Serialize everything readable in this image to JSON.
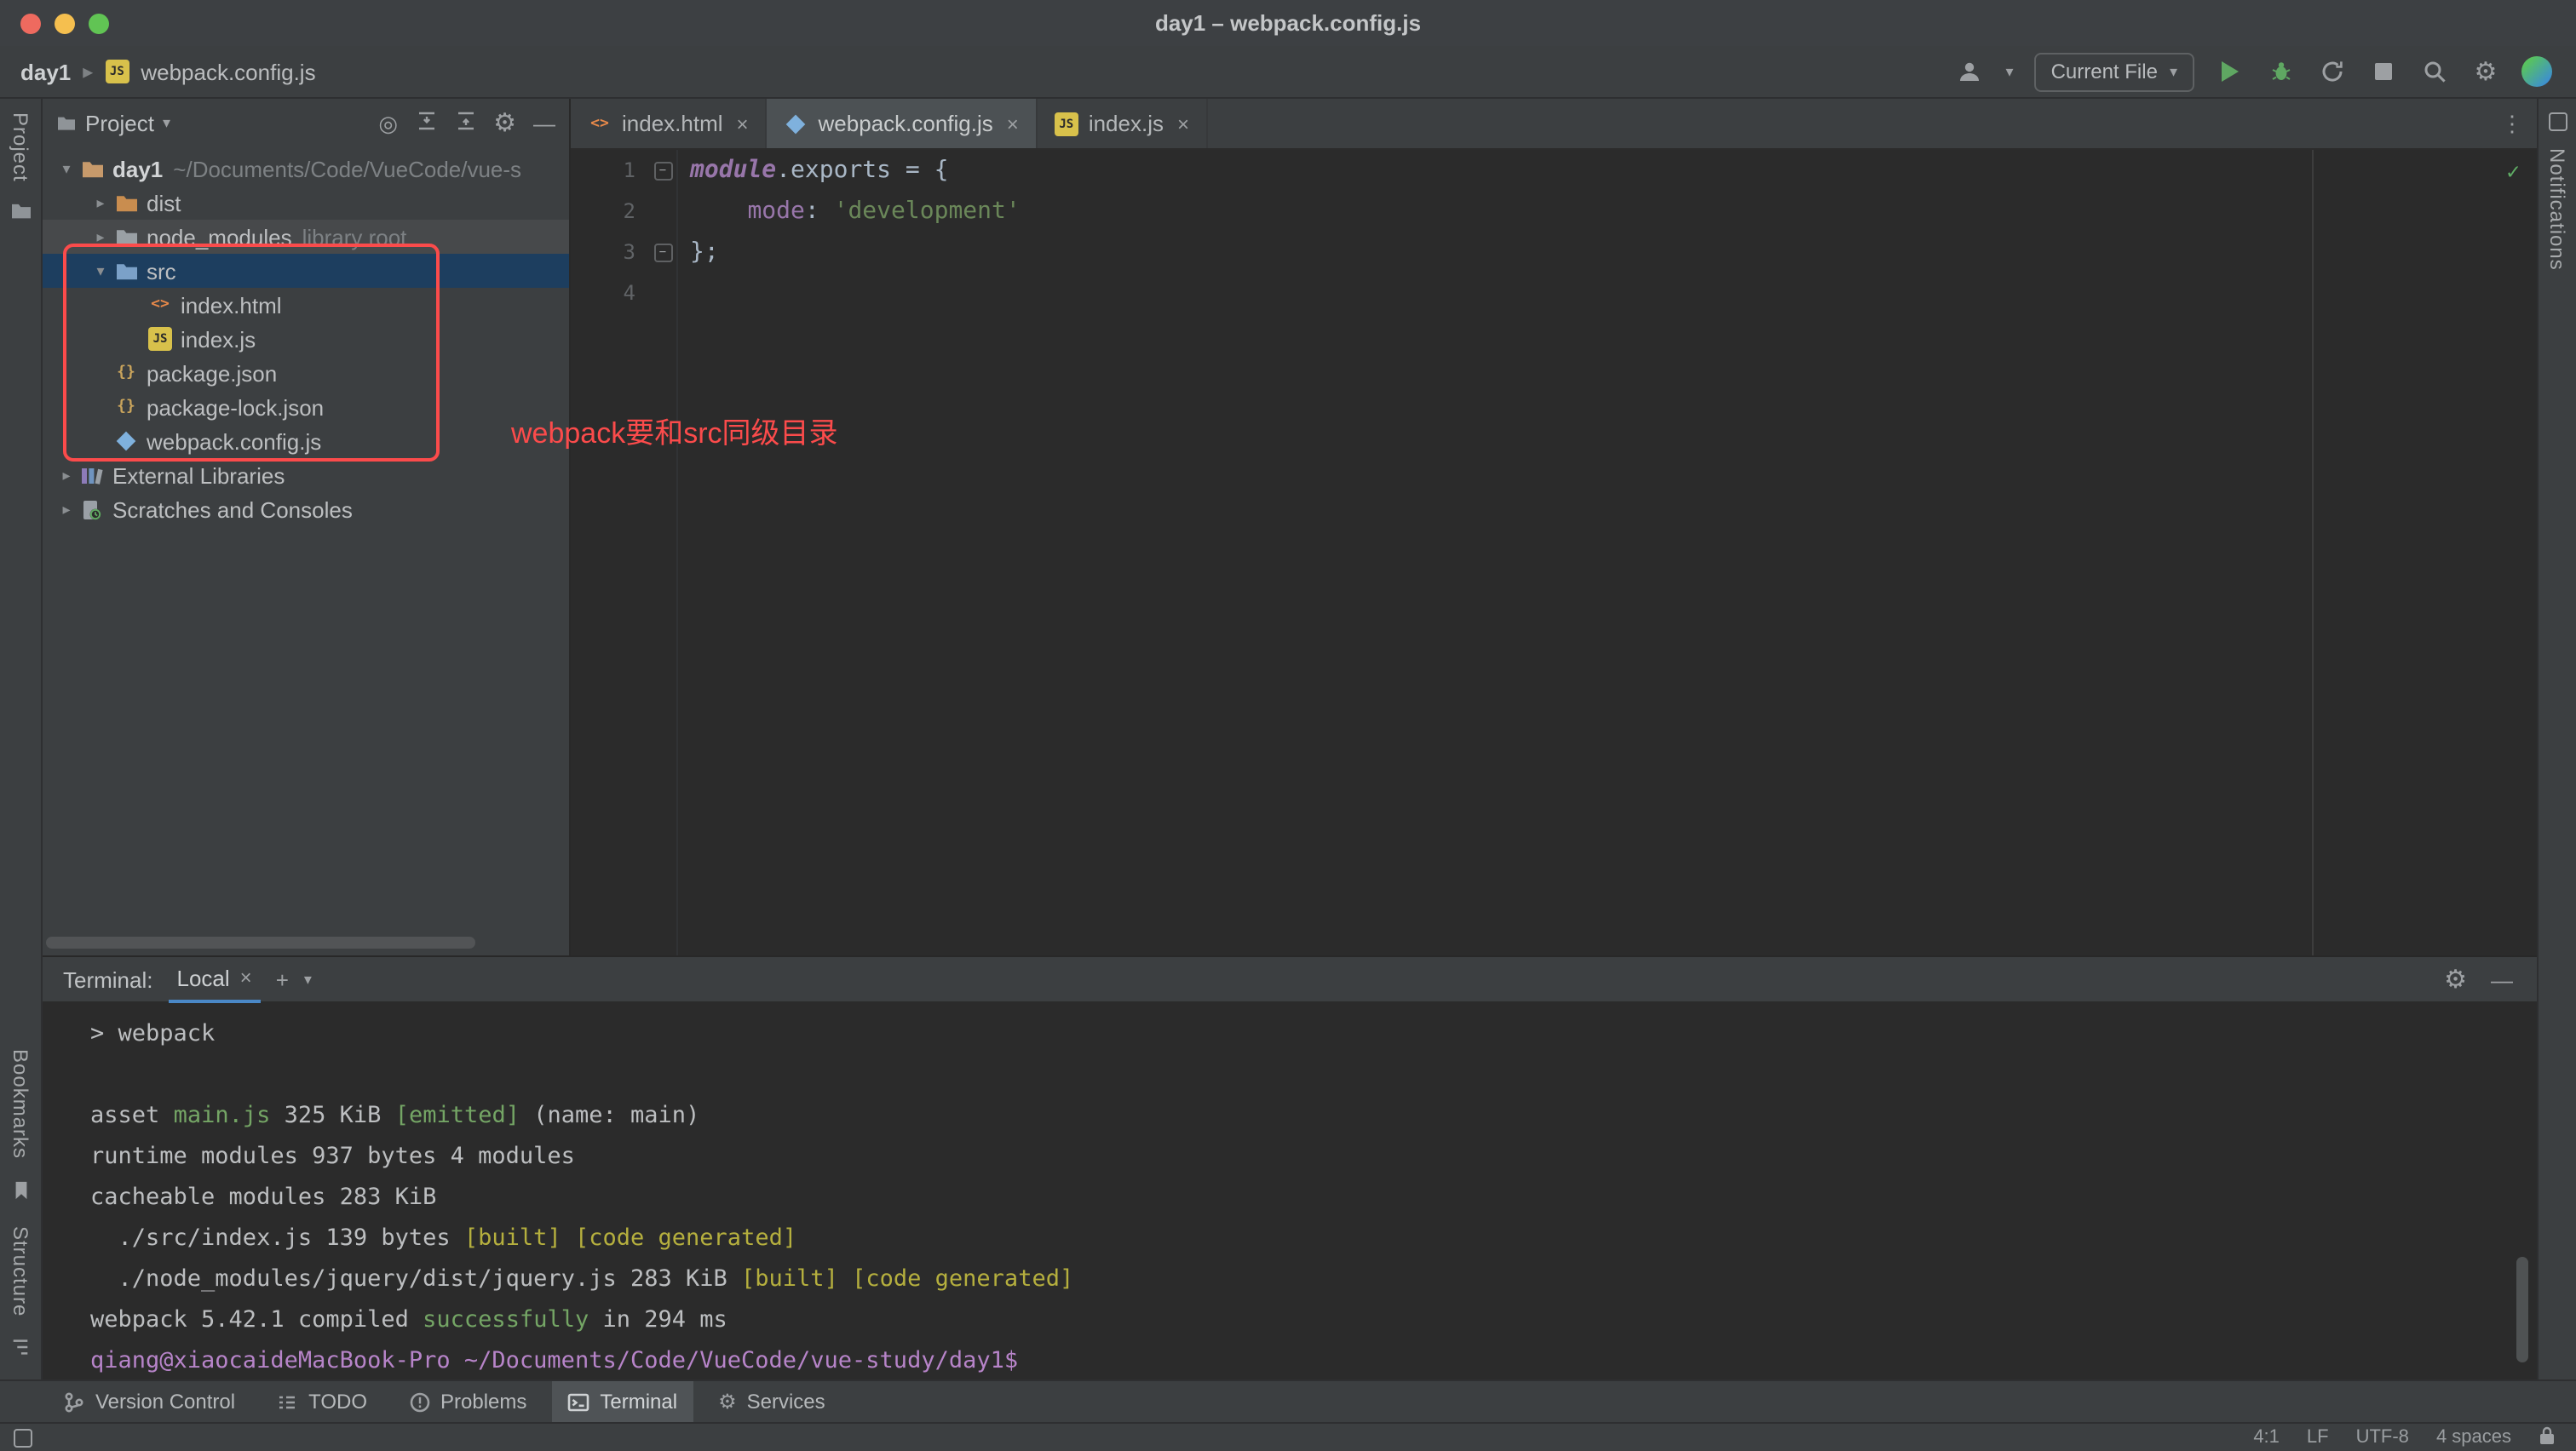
{
  "window": {
    "title": "day1 – webpack.config.js"
  },
  "breadcrumbs": {
    "project": "day1",
    "file": "webpack.config.js"
  },
  "toolbar": {
    "run_config_label": "Current File"
  },
  "stripes": {
    "left_top": "Project",
    "left_bottom": [
      "Bookmarks",
      "Structure"
    ],
    "right_top": "Notifications"
  },
  "project": {
    "header_title": "Project",
    "tree": [
      {
        "label": "day1",
        "path_suffix": "~/Documents/Code/VueCode/vue-s",
        "icon": "project-folder-icon"
      },
      {
        "label": "dist",
        "icon": "excluded-folder-icon"
      },
      {
        "label": "node_modules",
        "path_suffix": "library root",
        "icon": "folder-icon"
      },
      {
        "label": "src",
        "icon": "source-folder-icon"
      },
      {
        "label": "index.html",
        "icon": "html-file-icon"
      },
      {
        "label": "index.js",
        "icon": "js-file-icon"
      },
      {
        "label": "package.json",
        "icon": "json-file-icon"
      },
      {
        "label": "package-lock.json",
        "icon": "json-file-icon"
      },
      {
        "label": "webpack.config.js",
        "icon": "webpack-file-icon"
      },
      {
        "label": "External Libraries",
        "icon": "libraries-icon"
      },
      {
        "label": "Scratches and Consoles",
        "icon": "scratches-icon"
      }
    ]
  },
  "annotation": {
    "text": "webpack要和src同级目录",
    "color": "#fb4b4b"
  },
  "editor": {
    "tabs": [
      {
        "label": "index.html",
        "icon": "html-file-icon"
      },
      {
        "label": "webpack.config.js",
        "icon": "webpack-file-icon",
        "active": true
      },
      {
        "label": "index.js",
        "icon": "js-file-icon"
      }
    ],
    "code_lines": [
      {
        "num": "1",
        "segments": [
          {
            "text": "module"
          },
          {
            "text": ".exports = {"
          }
        ]
      },
      {
        "num": "2",
        "segments": [
          {
            "text": "    "
          },
          {
            "text": "mode"
          },
          {
            "text": ": "
          },
          {
            "text": "'development'"
          }
        ]
      },
      {
        "num": "3",
        "segments": [
          {
            "text": "};"
          }
        ]
      },
      {
        "num": "4",
        "segments": []
      }
    ]
  },
  "terminal": {
    "title": "Terminal:",
    "tab_label": "Local",
    "lines": [
      {
        "segments": [
          {
            "text": "> webpack",
            "color": "plain"
          }
        ]
      },
      {
        "segments": []
      },
      {
        "segments": [
          {
            "text": "asset ",
            "color": "plain"
          },
          {
            "text": "main.js",
            "color": "green"
          },
          {
            "text": " 325 KiB ",
            "color": "plain"
          },
          {
            "text": "[emitted]",
            "color": "green"
          },
          {
            "text": " (name: main)",
            "color": "plain"
          }
        ]
      },
      {
        "segments": [
          {
            "text": "runtime modules 937 bytes 4 modules",
            "color": "plain"
          }
        ]
      },
      {
        "segments": [
          {
            "text": "cacheable modules 283 KiB",
            "color": "plain"
          }
        ]
      },
      {
        "segments": [
          {
            "text": "  ./src/index.js 139 bytes ",
            "color": "plain"
          },
          {
            "text": "[built]",
            "color": "yellow"
          },
          {
            "text": " ",
            "color": "plain"
          },
          {
            "text": "[code generated]",
            "color": "yellow"
          }
        ]
      },
      {
        "segments": [
          {
            "text": "  ./node_modules/jquery/dist/jquery.js 283 KiB ",
            "color": "plain"
          },
          {
            "text": "[built]",
            "color": "yellow"
          },
          {
            "text": " ",
            "color": "plain"
          },
          {
            "text": "[code generated]",
            "color": "yellow"
          }
        ]
      },
      {
        "segments": [
          {
            "text": "webpack 5.42.1 compiled ",
            "color": "plain"
          },
          {
            "text": "successfully",
            "color": "green"
          },
          {
            "text": " in 294 ms",
            "color": "plain"
          }
        ]
      },
      {
        "segments": [
          {
            "text": "qiang@xiaocaideMacBook-Pro ~/Documents/Code/VueCode/vue-study/day1$",
            "color": "magenta"
          }
        ]
      }
    ]
  },
  "toolwindow_bar": {
    "items": [
      "Version Control",
      "TODO",
      "Problems",
      "Terminal",
      "Services"
    ],
    "active": "Terminal"
  },
  "status_bar": {
    "caret": "4:1",
    "line_separator": "LF",
    "encoding": "UTF-8",
    "indent": "4 spaces"
  },
  "icons": {
    "chevron_down": "▾",
    "chevron_right": "▸",
    "dropdown_arrow": "▾",
    "close": "×",
    "plus": "+",
    "more_vertical": "⋮",
    "gear": "⚙",
    "locate": "◎",
    "minimize": "—",
    "check": "✓",
    "fold_minus": "−",
    "js_badge": "JS",
    "html_badge": "<>",
    "json_badge": "{}"
  },
  "palette": {
    "terminal_green": "#74a565",
    "terminal_yellow": "#b5af3e",
    "terminal_magenta": "#b784c9",
    "selection_blue": "#1d3e5f",
    "annotation_red": "#fb4b4b",
    "accent_green": "#5fa762"
  }
}
